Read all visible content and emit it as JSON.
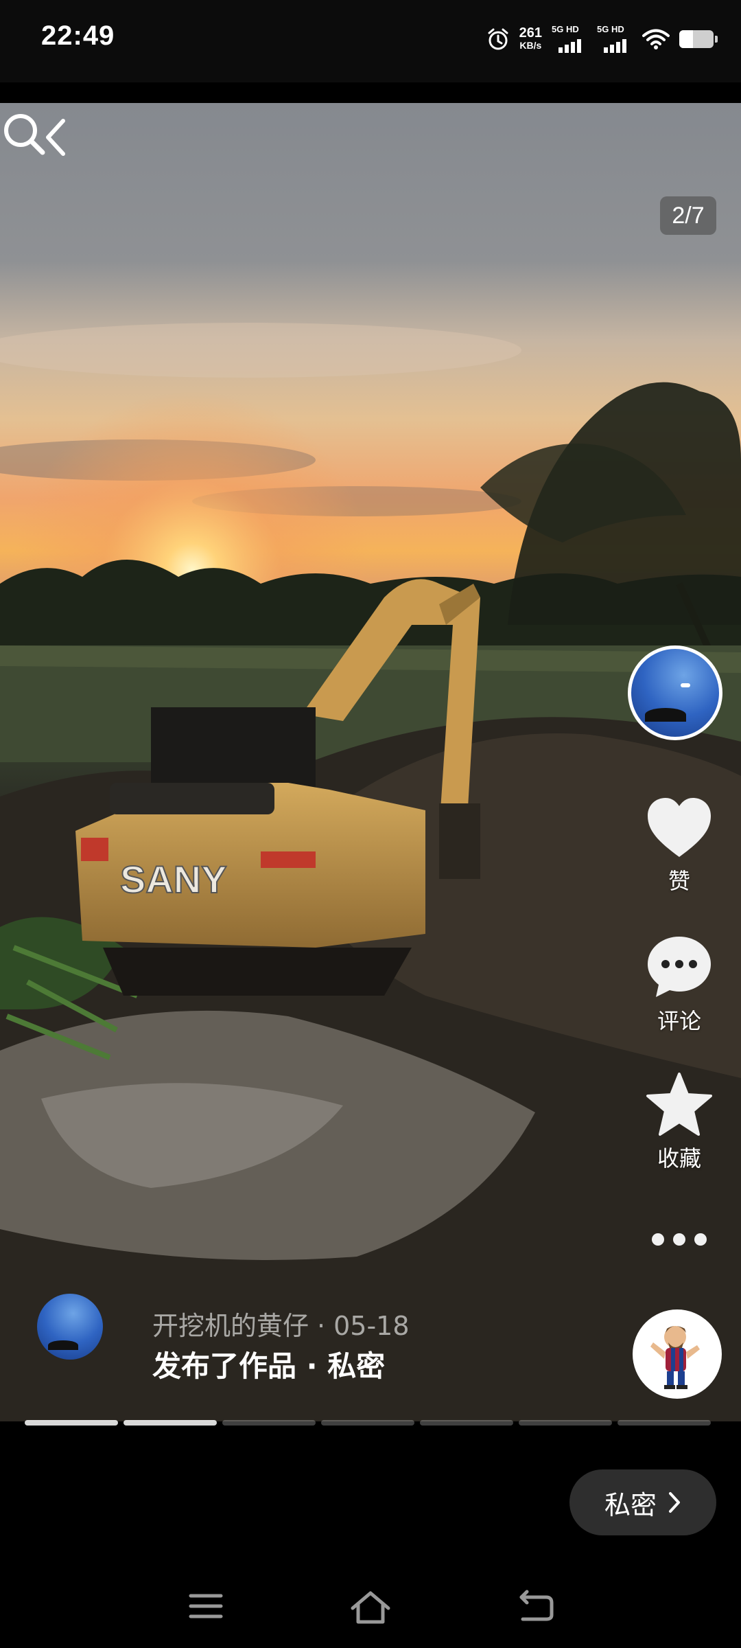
{
  "status_bar": {
    "time": "22:49",
    "net_speed_value": "261",
    "net_speed_unit": "KB/s",
    "sim1_label": "5G HD",
    "sim2_label": "5G HD",
    "icons": [
      "alarm-icon",
      "signal-icon",
      "wifi-icon",
      "battery-icon"
    ]
  },
  "header": {
    "page_counter": "2/7",
    "icons": [
      "back-icon",
      "search-icon"
    ]
  },
  "actions": {
    "like_label": "赞",
    "comment_label": "评论",
    "favorite_label": "收藏"
  },
  "post": {
    "author": "开挖机的黄仔",
    "separator": "·",
    "date": "05-18",
    "status": "发布了作品 · 私密",
    "image_count": 7,
    "current_image": 2
  },
  "bottom": {
    "privacy_label": "私密"
  },
  "colors": {
    "background": "#000000",
    "pill": "#2e2e2e",
    "accent_sky": "#f5b35a"
  }
}
